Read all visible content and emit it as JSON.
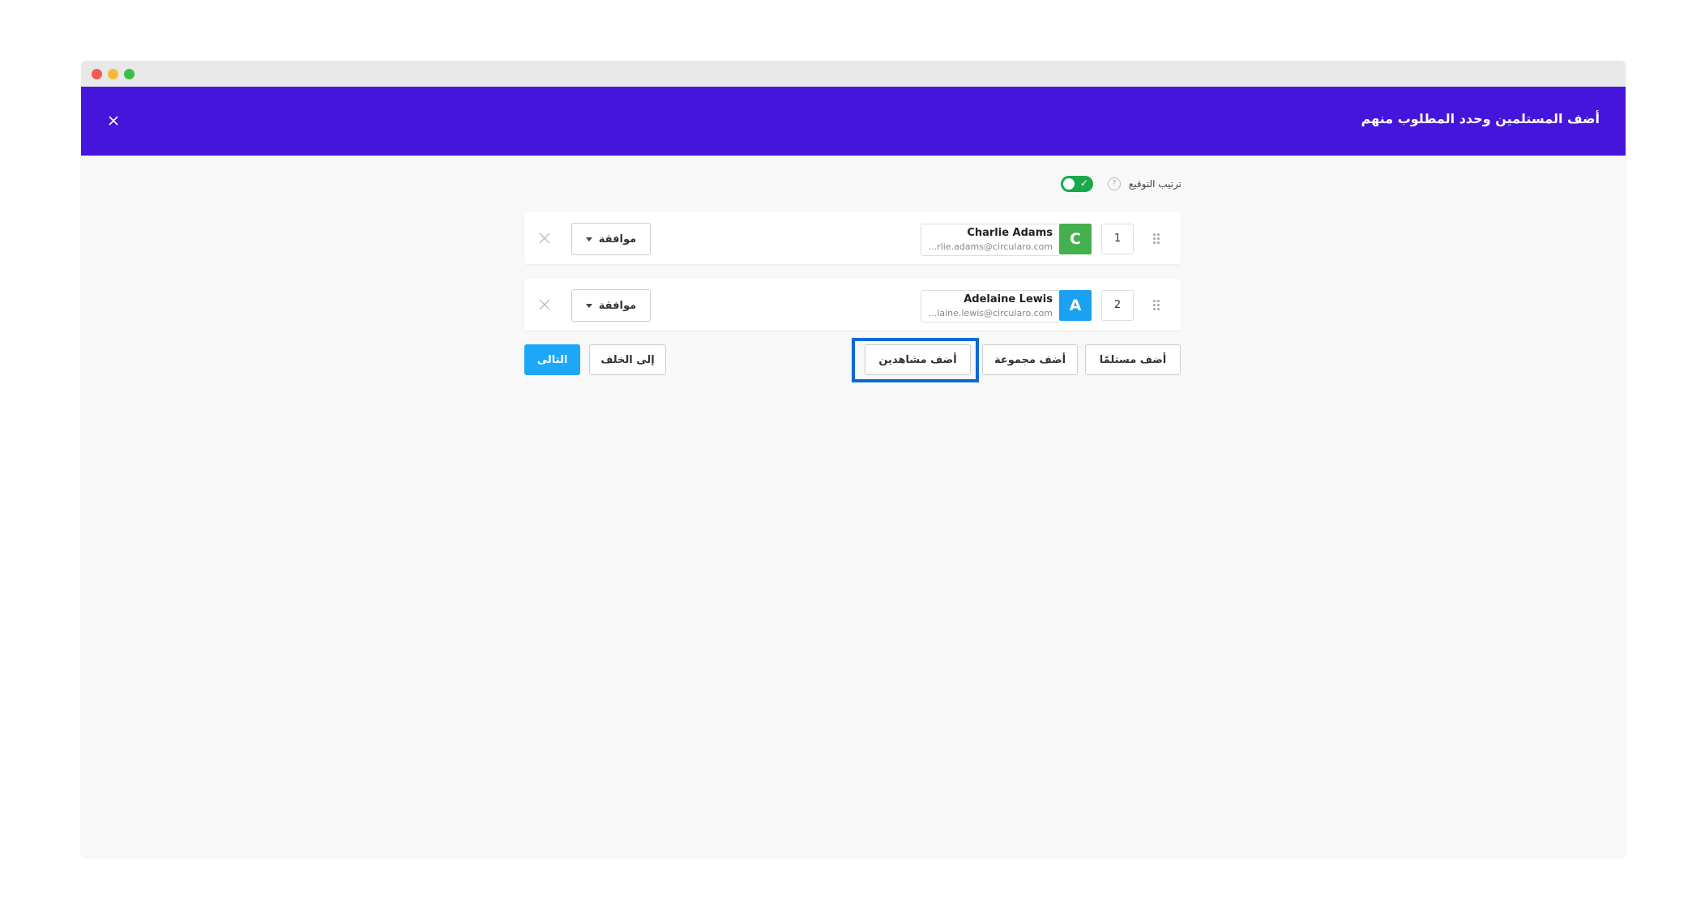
{
  "header": {
    "title": "أضف المستلمين وحدد المطلوب منهم"
  },
  "signing_order": {
    "label": "ترتيب التوقيع",
    "help": "?",
    "enabled": true
  },
  "recipients": [
    {
      "order": "1",
      "initial": "C",
      "name": "Charlie Adams",
      "email": "...rlie.adams@circularo.com",
      "action": "موافقة"
    },
    {
      "order": "2",
      "initial": "A",
      "name": "Adelaine Lewis",
      "email": "...laine.lewis@circularo.com",
      "action": "موافقة"
    }
  ],
  "actions": {
    "add_recipient": "أضف مستلمًا",
    "add_group": "أضف مجموعة",
    "add_viewers": "أضف مشاهدين",
    "back": "إلى الخلف",
    "next": "التالى"
  },
  "colors": {
    "header": "#4615dc",
    "toggle_on": "#19a94b",
    "avatar_1": "#44b04e",
    "avatar_2": "#1aa1f2",
    "primary_button": "#1ea7f7",
    "highlight": "#0b69d4"
  }
}
